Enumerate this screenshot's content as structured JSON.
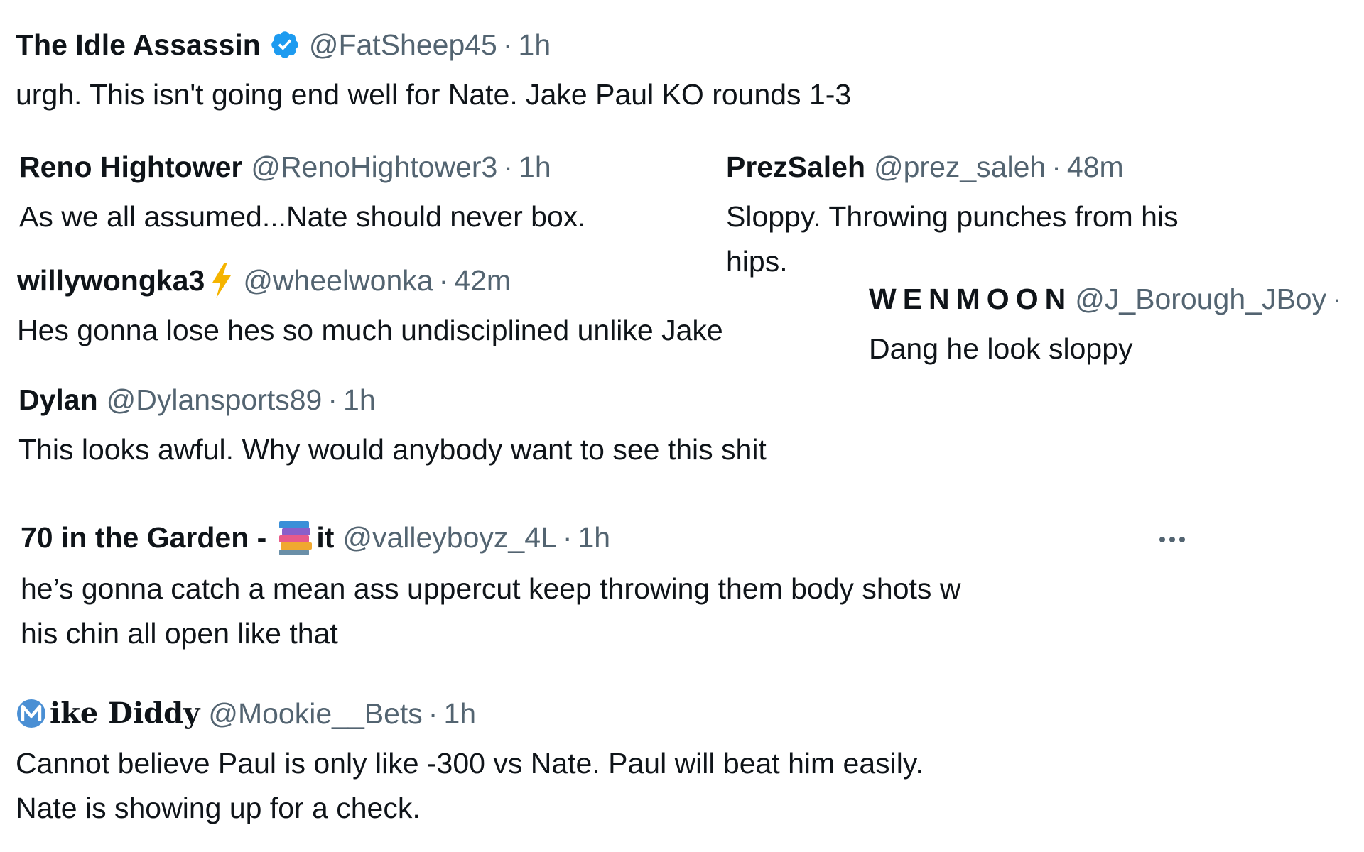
{
  "tweets": [
    {
      "name": "The Idle Assassin",
      "handle": "@FatSheep45",
      "dot": "·",
      "time": "1h",
      "text": "urgh. This isn't going end well for Nate. Jake Paul KO rounds 1-3",
      "badge": "verified-icon"
    },
    {
      "name": "Reno Hightower",
      "handle": "@RenoHightower3",
      "dot": "·",
      "time": "1h",
      "text": "As we all assumed...Nate should never box."
    },
    {
      "name": "PrezSaleh",
      "handle": "@prez_saleh",
      "dot": "·",
      "time": "48m",
      "text": "Sloppy. Throwing punches from his hips."
    },
    {
      "name": "willywongka3",
      "handle": "@wheelwonka",
      "dot": "·",
      "time": "42m",
      "text": "Hes gonna lose hes so much undisciplined unlike Jake",
      "badge": "lightning-bolt-icon"
    },
    {
      "name": "WENMOON",
      "handle": "@J_Borough_JBoy",
      "dot": "·",
      "text": "Dang he look sloppy"
    },
    {
      "name": "Dylan",
      "handle": "@Dylansports89",
      "dot": "·",
      "time": "1h",
      "text": "This looks awful. Why would anybody want to see this shit"
    },
    {
      "name_prefix": "70 in the Garden -",
      "name_suffix": "it",
      "handle": "@valleyboyz_4L",
      "dot": "·",
      "time": "1h",
      "text": "he’s gonna catch a mean ass uppercut keep throwing them body shots w\nhis chin all open like that",
      "badge": "books-icon"
    },
    {
      "name": "ike Diddy",
      "handle": "@Mookie__Bets",
      "dot": "·",
      "time": "1h",
      "text": "Cannot believe Paul is only like -300 vs Nate. Paul will beat him easily.\nNate is showing up for a check.",
      "badge": "m-avatar-icon"
    }
  ],
  "colors": {
    "text_primary": "#0f1419",
    "text_secondary": "#536471",
    "verified_blue": "#1d9bf0",
    "bolt_yellow": "#f5b400"
  }
}
